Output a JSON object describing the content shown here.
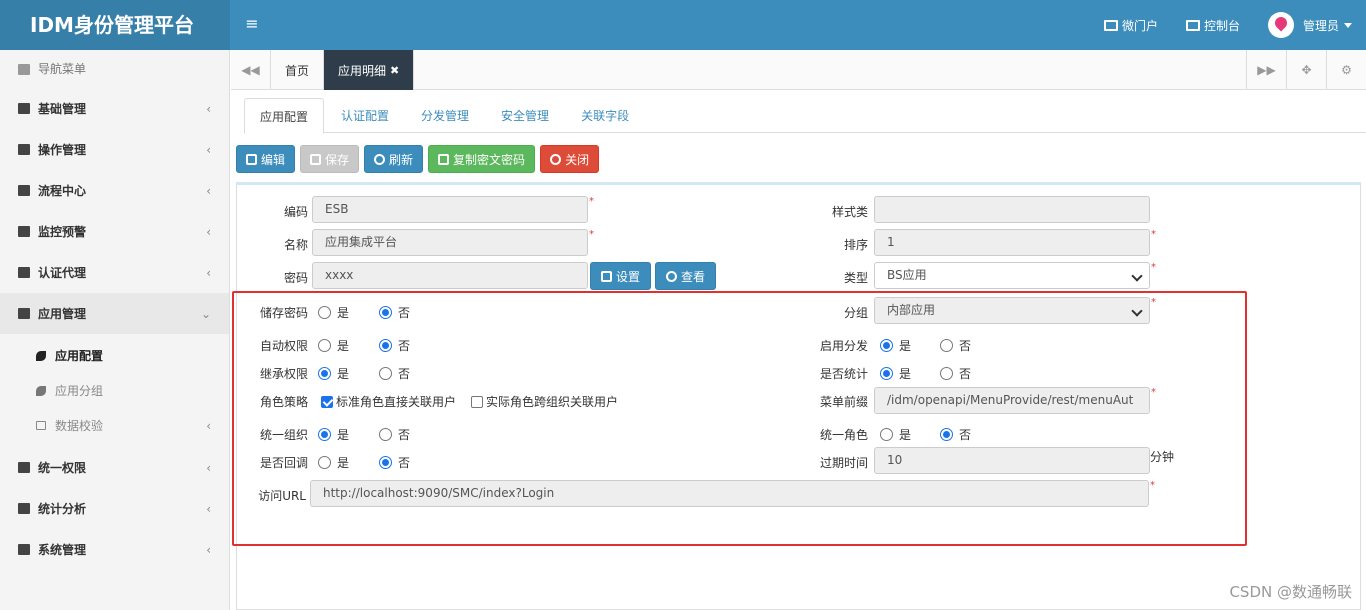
{
  "app": {
    "title": "IDM身份管理平台"
  },
  "header": {
    "menu_toggle": "≡",
    "links": [
      {
        "label": "微门户",
        "icon": "portal-card-icon"
      },
      {
        "label": "控制台",
        "icon": "monitor-icon"
      }
    ],
    "user": {
      "name": "管理员",
      "icon": "user-avatar-icon"
    }
  },
  "sidebar": {
    "heading": "导航菜单",
    "items": [
      {
        "label": "基础管理",
        "icon": "id-card-icon"
      },
      {
        "label": "操作管理",
        "icon": "book-icon"
      },
      {
        "label": "流程中心",
        "icon": "shuffle-icon"
      },
      {
        "label": "监控预警",
        "icon": "eye-icon"
      },
      {
        "label": "认证代理",
        "icon": "users-icon"
      },
      {
        "label": "应用管理",
        "icon": "list-icon",
        "expanded": true
      }
    ],
    "sub_items": [
      {
        "label": "应用配置",
        "icon": "leaf-icon",
        "active": true
      },
      {
        "label": "应用分组",
        "icon": "leaf-icon"
      },
      {
        "label": "数据校验",
        "icon": "folder-icon"
      }
    ],
    "items_after": [
      {
        "label": "统一权限",
        "icon": "sitemap-icon"
      },
      {
        "label": "统计分析",
        "icon": "area-chart-icon"
      },
      {
        "label": "系统管理",
        "icon": "gears-icon"
      }
    ]
  },
  "tabsbar": {
    "tabs": [
      {
        "label": "首页"
      },
      {
        "label": "应用明细",
        "closable": true,
        "active": true
      }
    ]
  },
  "sub_tabs": [
    "应用配置",
    "认证配置",
    "分发管理",
    "安全管理",
    "关联字段"
  ],
  "toolbar": {
    "edit": "编辑",
    "save": "保存",
    "refresh": "刷新",
    "copy_cipher": "复制密文密码",
    "close": "关闭"
  },
  "form": {
    "code": {
      "label": "编码",
      "value": "ESB"
    },
    "name": {
      "label": "名称",
      "value": "应用集成平台"
    },
    "password": {
      "label": "密码",
      "value": "xxxx",
      "set_btn": "设置",
      "view_btn": "查看"
    },
    "style_class": {
      "label": "样式类",
      "value": ""
    },
    "order": {
      "label": "排序",
      "value": "1"
    },
    "type": {
      "label": "类型",
      "value": "BS应用"
    },
    "store_password": {
      "label": "储存密码",
      "yes": "是",
      "no": "否",
      "selected": "否"
    },
    "group": {
      "label": "分组",
      "value": "内部应用"
    },
    "auto_permission": {
      "label": "自动权限",
      "yes": "是",
      "no": "否",
      "selected": "否"
    },
    "enable_dist": {
      "label": "启用分发",
      "yes": "是",
      "no": "否",
      "selected": "是"
    },
    "inherit_permission": {
      "label": "继承权限",
      "yes": "是",
      "no": "否",
      "selected": "是"
    },
    "statistics": {
      "label": "是否统计",
      "yes": "是",
      "no": "否",
      "selected": "是"
    },
    "role_policy": {
      "label": "角色策略",
      "opt1": "标准角色直接关联用户",
      "opt1_checked": true,
      "opt2": "实际角色跨组织关联用户",
      "opt2_checked": false
    },
    "menu_prefix": {
      "label": "菜单前缀",
      "value": "/idm/openapi/MenuProvide/rest/menuAut"
    },
    "unified_org": {
      "label": "统一组织",
      "yes": "是",
      "no": "否",
      "selected": "是"
    },
    "unified_role": {
      "label": "统一角色",
      "yes": "是",
      "no": "否",
      "selected": "否"
    },
    "callback": {
      "label": "是否回调",
      "yes": "是",
      "no": "否",
      "selected": "否"
    },
    "expire": {
      "label": "过期时间",
      "value": "10",
      "unit": "分钟"
    },
    "url": {
      "label": "访问URL",
      "value": "http://localhost:9090/SMC/index?Login"
    },
    "required_mark": "*"
  },
  "watermark": "CSDN @数通畅联",
  "colors": {
    "header": "#3c8dbc",
    "logo_bg": "#367fa9",
    "active_tab": "#2f3d4a",
    "highlight": "#e03030"
  }
}
